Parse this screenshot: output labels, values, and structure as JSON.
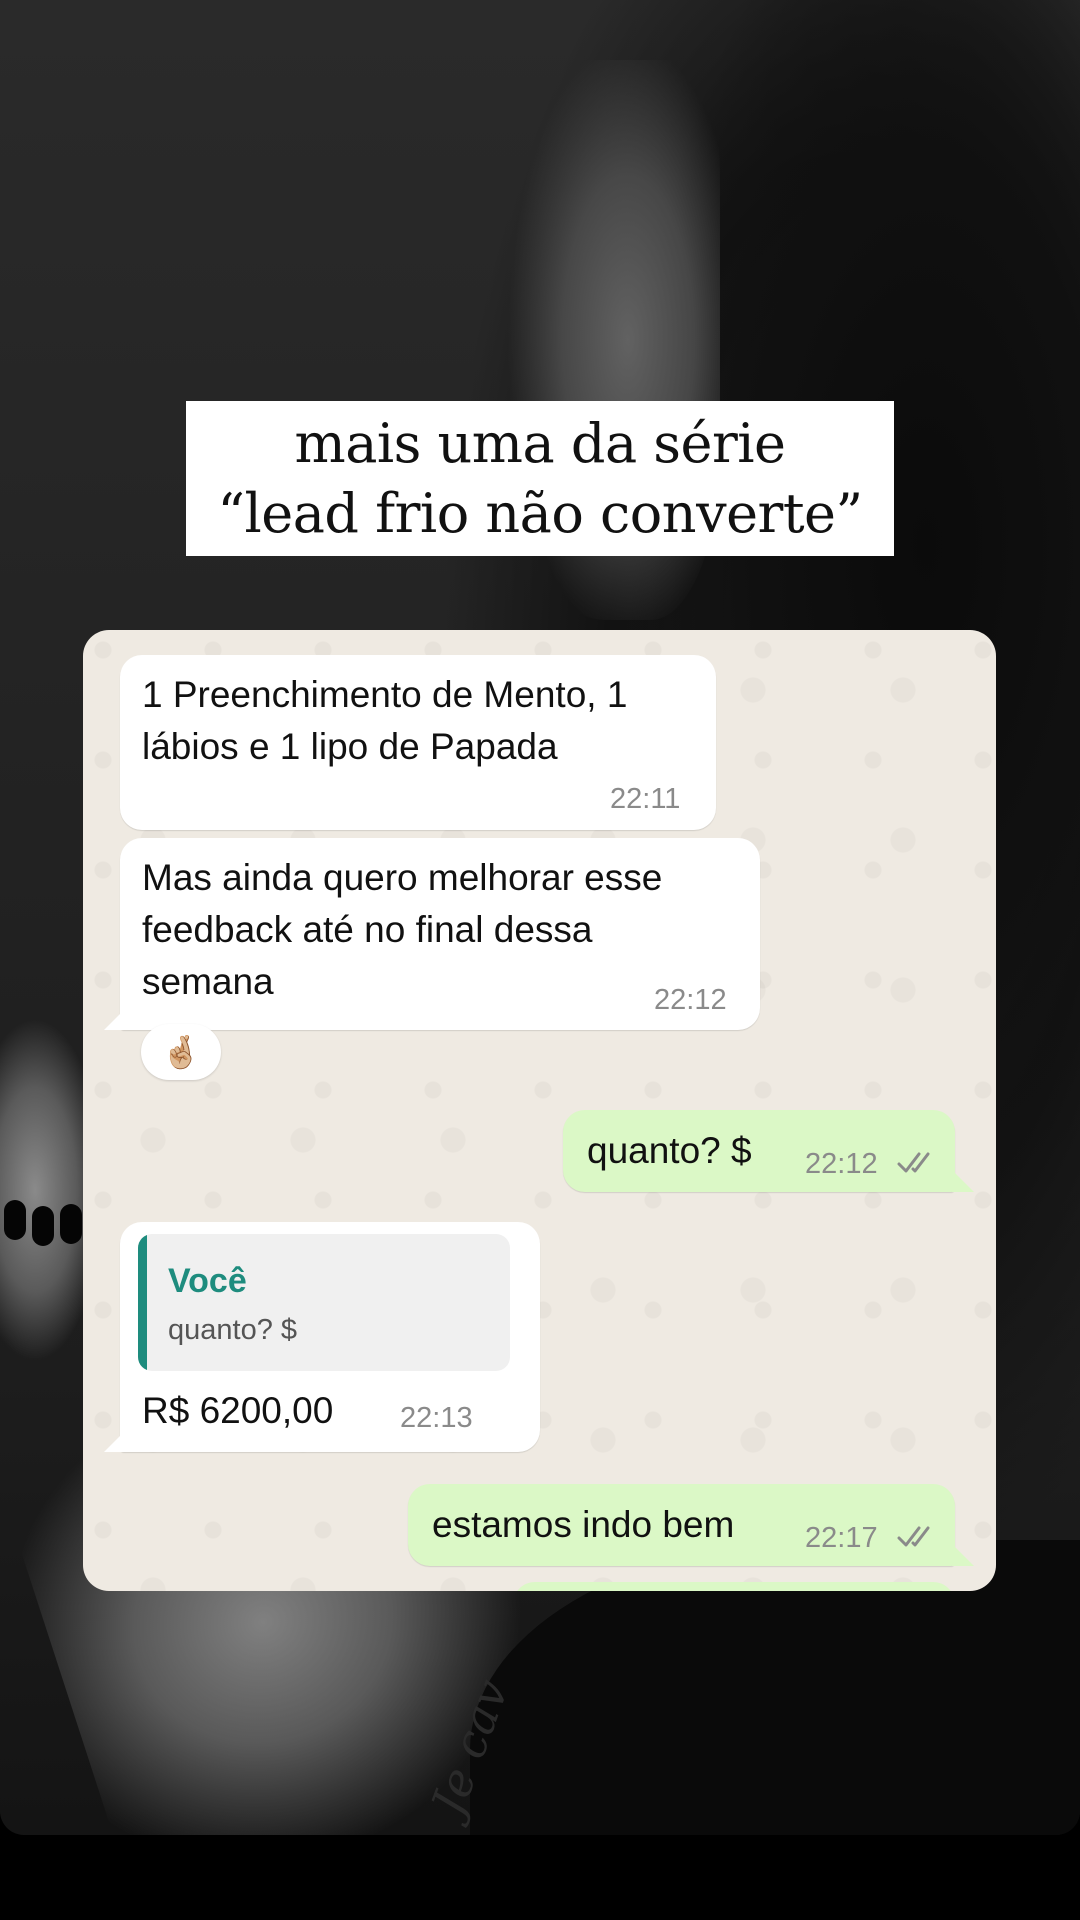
{
  "story": {
    "title_lines": [
      "mais uma da série",
      "“lead frio não converte”"
    ],
    "tattoo_text": "Je cav"
  },
  "chat": {
    "messages": [
      {
        "direction": "in",
        "lines": [
          "1 Preenchimento de Mento, 1",
          "lábios e 1 lipo de Papada"
        ],
        "time": "22:11"
      },
      {
        "direction": "in",
        "lines": [
          "Mas ainda quero melhorar esse",
          "feedback até no final dessa",
          "semana"
        ],
        "time": "22:12",
        "reaction": "🤞🏼"
      },
      {
        "direction": "out",
        "lines": [
          "quanto? $"
        ],
        "time": "22:12",
        "status": "read"
      },
      {
        "direction": "in",
        "reply_to": {
          "author": "Você",
          "text": "quanto? $"
        },
        "lines": [
          "R$ 6200,00"
        ],
        "time": "22:13"
      },
      {
        "direction": "out",
        "lines": [
          "estamos indo bem"
        ],
        "time": "22:17",
        "status": "read"
      }
    ]
  },
  "colors": {
    "chat_background": "#efeae2",
    "incoming_bubble": "#ffffff",
    "outgoing_bubble": "#dbf8c6",
    "reply_accent": "#1e8c7e",
    "read_ticks": "#8a8a8a"
  },
  "icons": {
    "read_receipt": "double-check-icon",
    "reaction": "crossed-fingers-emoji"
  }
}
